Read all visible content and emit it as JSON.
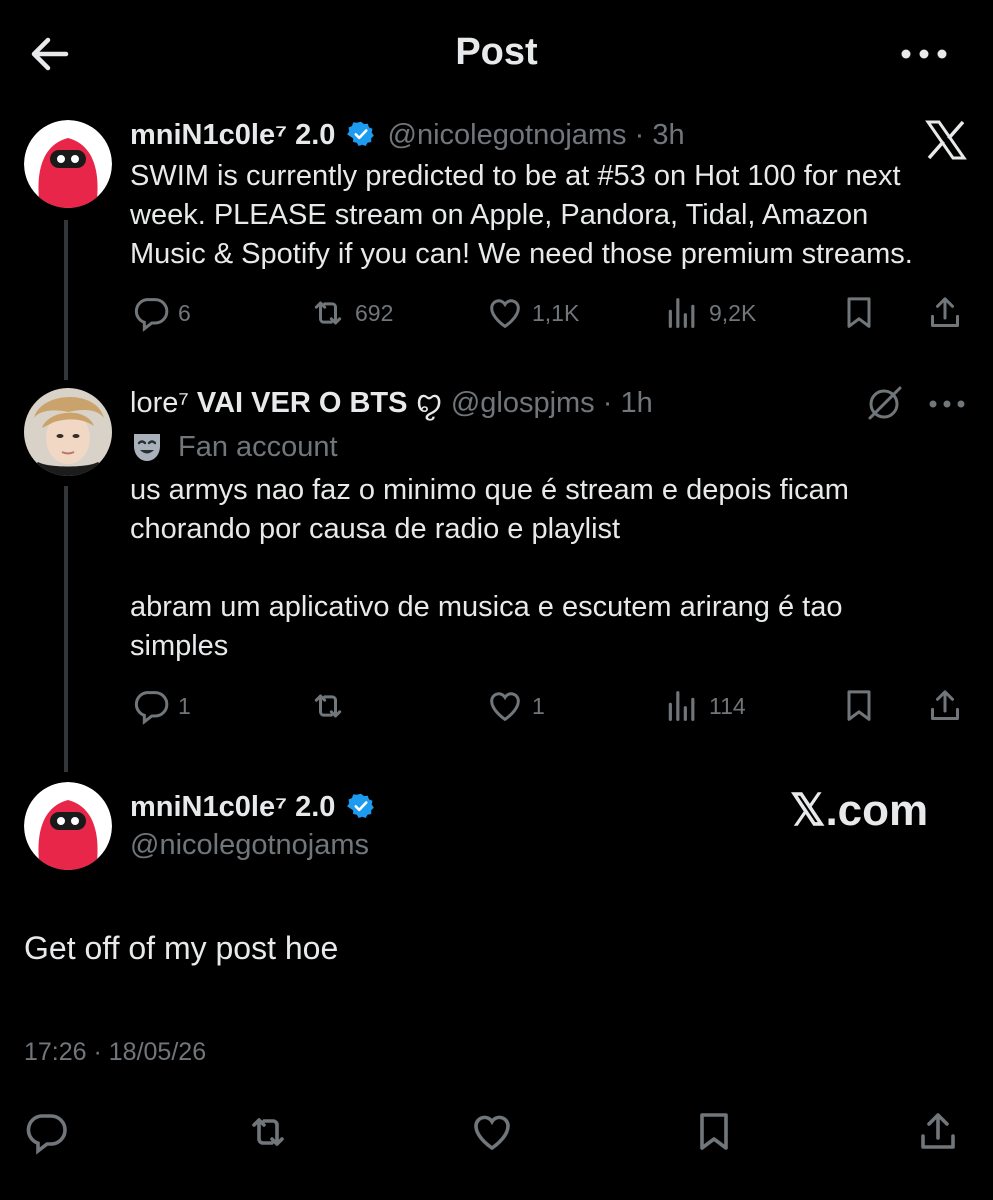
{
  "header": {
    "title": "Post"
  },
  "tweet1": {
    "name": "mniN1c0le⁷ 2.0",
    "handle": "@nicolegotnojams",
    "time": "· 3h",
    "text_lines": [
      "SWIM is currently predicted to be at #53 on Hot 100 for next",
      "week. PLEASE stream on Apple, Pandora, Tidal, Amazon",
      "Music & Spotify if you can! We need those premium streams."
    ],
    "replies": "6",
    "retweets": "692",
    "likes": "1,1K",
    "views": "9,2K"
  },
  "tweet2": {
    "name_prefix": "lore⁷ ",
    "name_bold": "VAI VER O BTS",
    "name_suffix": " ꨄ",
    "handle": "@glospjms",
    "time": "· 1h",
    "label": "Fan account",
    "para1_lines": [
      "us armys nao faz o minimo que é stream e depois ficam",
      "chorando por causa de radio e playlist"
    ],
    "para2_lines": [
      "abram um aplicativo de musica e escutem arirang é tao",
      "simples"
    ],
    "replies": "1",
    "likes": "1",
    "views": "114"
  },
  "main": {
    "name": "mniN1c0le⁷ 2.0",
    "handle": "@nicolegotnojams",
    "watermark": "𝕏.com",
    "text": "Get off of my post hoe",
    "timestamp": "17:26 · 18/05/26"
  },
  "colors": {
    "verified": "#1d9bf0",
    "muted": "#71767b",
    "avatar_red": "#e8264a"
  }
}
